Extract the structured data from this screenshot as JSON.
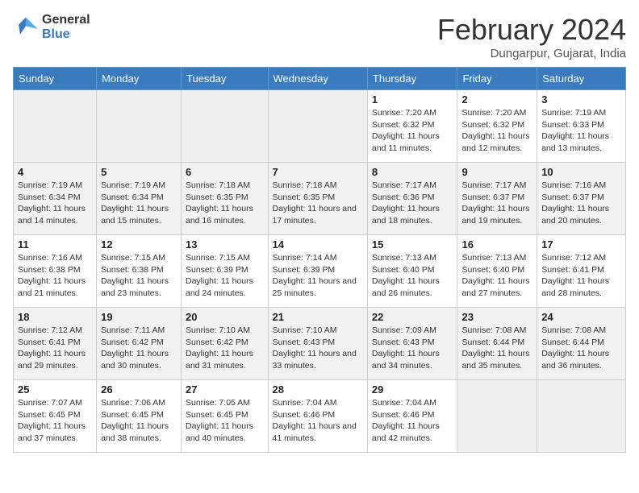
{
  "logo": {
    "line1": "General",
    "line2": "Blue"
  },
  "title": "February 2024",
  "subtitle": "Dungarpur, Gujarat, India",
  "headers": [
    "Sunday",
    "Monday",
    "Tuesday",
    "Wednesday",
    "Thursday",
    "Friday",
    "Saturday"
  ],
  "weeks": [
    [
      {
        "day": "",
        "info": ""
      },
      {
        "day": "",
        "info": ""
      },
      {
        "day": "",
        "info": ""
      },
      {
        "day": "",
        "info": ""
      },
      {
        "day": "1",
        "info": "Sunrise: 7:20 AM\nSunset: 6:32 PM\nDaylight: 11 hours\nand 11 minutes."
      },
      {
        "day": "2",
        "info": "Sunrise: 7:20 AM\nSunset: 6:32 PM\nDaylight: 11 hours\nand 12 minutes."
      },
      {
        "day": "3",
        "info": "Sunrise: 7:19 AM\nSunset: 6:33 PM\nDaylight: 11 hours\nand 13 minutes."
      }
    ],
    [
      {
        "day": "4",
        "info": "Sunrise: 7:19 AM\nSunset: 6:34 PM\nDaylight: 11 hours\nand 14 minutes."
      },
      {
        "day": "5",
        "info": "Sunrise: 7:19 AM\nSunset: 6:34 PM\nDaylight: 11 hours\nand 15 minutes."
      },
      {
        "day": "6",
        "info": "Sunrise: 7:18 AM\nSunset: 6:35 PM\nDaylight: 11 hours\nand 16 minutes."
      },
      {
        "day": "7",
        "info": "Sunrise: 7:18 AM\nSunset: 6:35 PM\nDaylight: 11 hours\nand 17 minutes."
      },
      {
        "day": "8",
        "info": "Sunrise: 7:17 AM\nSunset: 6:36 PM\nDaylight: 11 hours\nand 18 minutes."
      },
      {
        "day": "9",
        "info": "Sunrise: 7:17 AM\nSunset: 6:37 PM\nDaylight: 11 hours\nand 19 minutes."
      },
      {
        "day": "10",
        "info": "Sunrise: 7:16 AM\nSunset: 6:37 PM\nDaylight: 11 hours\nand 20 minutes."
      }
    ],
    [
      {
        "day": "11",
        "info": "Sunrise: 7:16 AM\nSunset: 6:38 PM\nDaylight: 11 hours\nand 21 minutes."
      },
      {
        "day": "12",
        "info": "Sunrise: 7:15 AM\nSunset: 6:38 PM\nDaylight: 11 hours\nand 23 minutes."
      },
      {
        "day": "13",
        "info": "Sunrise: 7:15 AM\nSunset: 6:39 PM\nDaylight: 11 hours\nand 24 minutes."
      },
      {
        "day": "14",
        "info": "Sunrise: 7:14 AM\nSunset: 6:39 PM\nDaylight: 11 hours\nand 25 minutes."
      },
      {
        "day": "15",
        "info": "Sunrise: 7:13 AM\nSunset: 6:40 PM\nDaylight: 11 hours\nand 26 minutes."
      },
      {
        "day": "16",
        "info": "Sunrise: 7:13 AM\nSunset: 6:40 PM\nDaylight: 11 hours\nand 27 minutes."
      },
      {
        "day": "17",
        "info": "Sunrise: 7:12 AM\nSunset: 6:41 PM\nDaylight: 11 hours\nand 28 minutes."
      }
    ],
    [
      {
        "day": "18",
        "info": "Sunrise: 7:12 AM\nSunset: 6:41 PM\nDaylight: 11 hours\nand 29 minutes."
      },
      {
        "day": "19",
        "info": "Sunrise: 7:11 AM\nSunset: 6:42 PM\nDaylight: 11 hours\nand 30 minutes."
      },
      {
        "day": "20",
        "info": "Sunrise: 7:10 AM\nSunset: 6:42 PM\nDaylight: 11 hours\nand 31 minutes."
      },
      {
        "day": "21",
        "info": "Sunrise: 7:10 AM\nSunset: 6:43 PM\nDaylight: 11 hours\nand 33 minutes."
      },
      {
        "day": "22",
        "info": "Sunrise: 7:09 AM\nSunset: 6:43 PM\nDaylight: 11 hours\nand 34 minutes."
      },
      {
        "day": "23",
        "info": "Sunrise: 7:08 AM\nSunset: 6:44 PM\nDaylight: 11 hours\nand 35 minutes."
      },
      {
        "day": "24",
        "info": "Sunrise: 7:08 AM\nSunset: 6:44 PM\nDaylight: 11 hours\nand 36 minutes."
      }
    ],
    [
      {
        "day": "25",
        "info": "Sunrise: 7:07 AM\nSunset: 6:45 PM\nDaylight: 11 hours\nand 37 minutes."
      },
      {
        "day": "26",
        "info": "Sunrise: 7:06 AM\nSunset: 6:45 PM\nDaylight: 11 hours\nand 38 minutes."
      },
      {
        "day": "27",
        "info": "Sunrise: 7:05 AM\nSunset: 6:45 PM\nDaylight: 11 hours\nand 40 minutes."
      },
      {
        "day": "28",
        "info": "Sunrise: 7:04 AM\nSunset: 6:46 PM\nDaylight: 11 hours\nand 41 minutes."
      },
      {
        "day": "29",
        "info": "Sunrise: 7:04 AM\nSunset: 6:46 PM\nDaylight: 11 hours\nand 42 minutes."
      },
      {
        "day": "",
        "info": ""
      },
      {
        "day": "",
        "info": ""
      }
    ]
  ]
}
